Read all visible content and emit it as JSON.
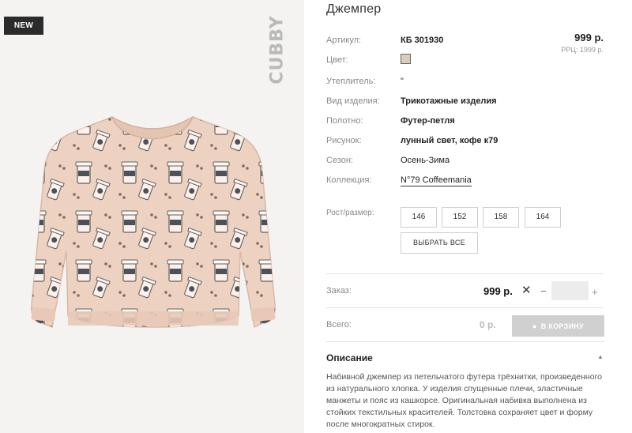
{
  "product": {
    "badge": "NEW",
    "brand": "CUBBY",
    "title": "Джемпер",
    "price": "999 р.",
    "rrp": "РРЦ: 1999 р.",
    "colors": {
      "swatch": "#d9cdb8",
      "fabric": "#edd1c1"
    }
  },
  "attributes": [
    {
      "label": "Артикул:",
      "value": "КБ 301930"
    },
    {
      "label": "Цвет:",
      "value": ""
    },
    {
      "label": "Утеплитель:",
      "value": "\""
    },
    {
      "label": "Вид изделия:",
      "value": "Трикотажные изделия"
    },
    {
      "label": "Полотно:",
      "value": "Футер-петля"
    },
    {
      "label": "Рисунок:",
      "value": "лунный свет, кофе к79"
    },
    {
      "label": "Сезон:",
      "value": "Осень-Зима"
    },
    {
      "label": "Коллекция:",
      "value": "N°79 Coffeemania"
    }
  ],
  "sizes": {
    "label": "Рост/размер:",
    "options": [
      "146",
      "152",
      "158",
      "164"
    ],
    "select_all": "ВЫБРАТЬ ВСЕ"
  },
  "order": {
    "label": "Заказ:",
    "price": "999 р.",
    "times": "✕",
    "minus": "−",
    "quantity": "",
    "plus": "+"
  },
  "total": {
    "label": "Всего:",
    "value": "0 р.",
    "cart_button": "В КОРЗИНУ"
  },
  "description": {
    "title": "Описание",
    "text": "Набивной джемпер из петельчатого футера трёхнитки, произведенного из натурального хлопка. У изделия спущенные плечи, эластичные манжеты и пояс из кашкорсе. Оригинальная набивка выполнена из стойких текстильных красителей. Толстовка сохраняет цвет и форму после многократных стирок."
  }
}
